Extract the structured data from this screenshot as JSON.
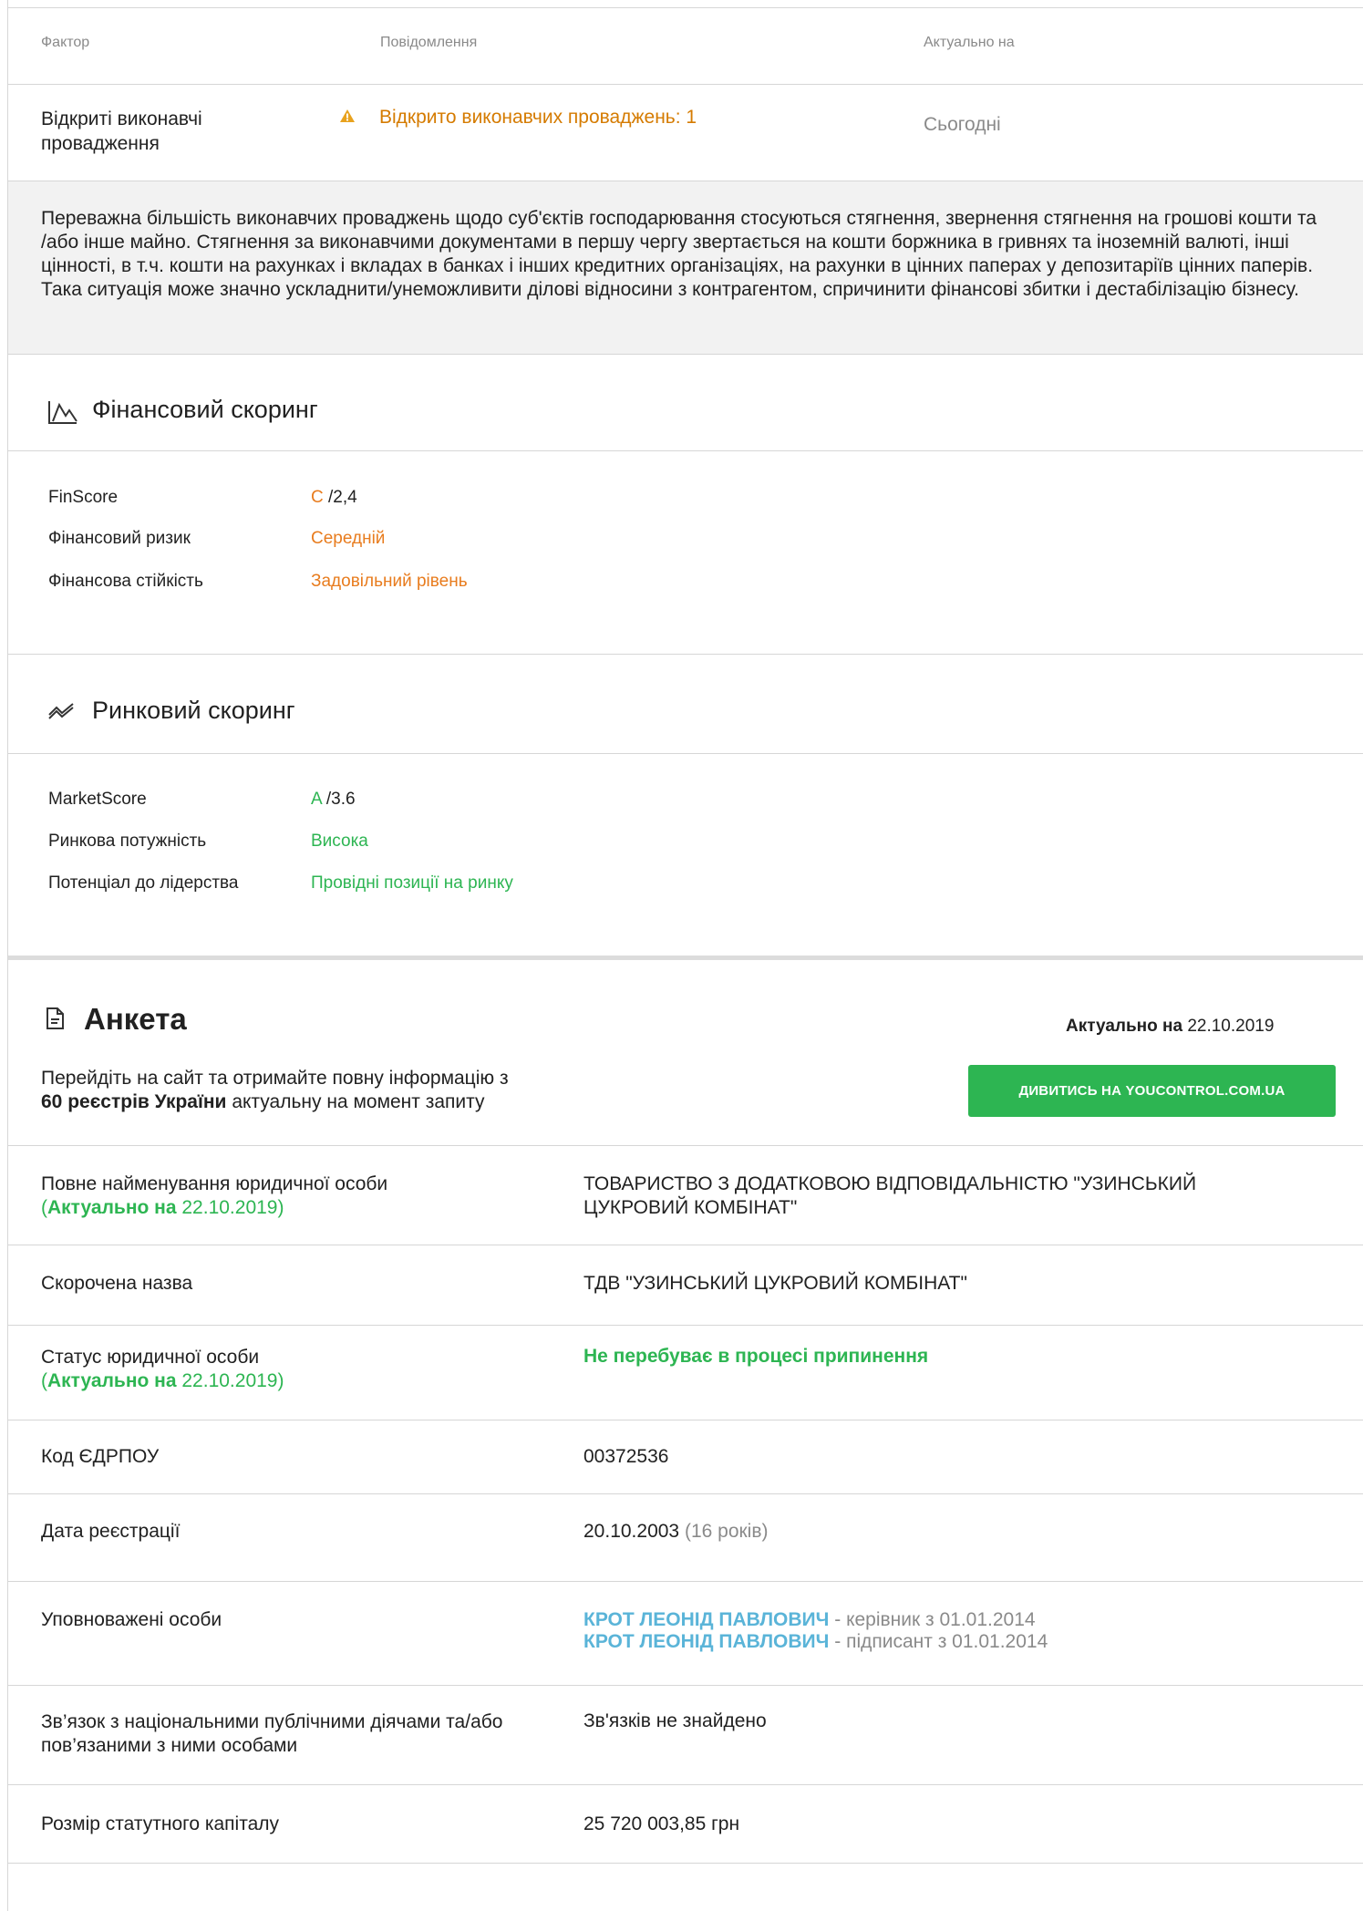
{
  "factors_table": {
    "headers": [
      "Фактор",
      "Повідомлення",
      "Актуально на"
    ],
    "row": {
      "factor": "Відкриті виконавчі провадження",
      "message": "Відкрито виконавчих проваджень: 1",
      "date": "Сьогодні"
    },
    "description": "Переважна більшість виконавчих проваджень щодо суб'єктів господарювання стосуються стягнення, звернення стягнення на грошові кошти та /або інше майно. Стягнення за виконавчими документами в першу чергу звертається на кошти боржника в гривнях та іноземній валюті, інші цінності, в т.ч. кошти на рахунках і вкладах в банках і інших кредитних організаціях, на рахунки в цінних паперах у депозитаріїв цінних паперів. Така ситуація може значно ускладнити/унеможливити ділові відносини з контрагентом, спричинити фінансові збитки і дестабілізацію бізнесу."
  },
  "financial_scoring": {
    "title": "Фінансовий скоринг",
    "rows": [
      {
        "label": "FinScore",
        "grade": "C",
        "score": " /2,4"
      },
      {
        "label": "Фінансовий ризик",
        "value": "Середній"
      },
      {
        "label": "Фінансова стійкість",
        "value": "Задовільний рівень"
      }
    ]
  },
  "market_scoring": {
    "title": "Ринковий скоринг",
    "rows": [
      {
        "label": "MarketScore",
        "grade": "A",
        "score": " /3.6"
      },
      {
        "label": "Ринкова потужність",
        "value": "Висока"
      },
      {
        "label": "Потенціал до лідерства",
        "value": "Провідні позиції на ринку"
      }
    ]
  },
  "anketa": {
    "title": "Анкета",
    "actual_label": "Актуально на",
    "actual_date": "22.10.2019",
    "promo_line1": "Перейдіть на сайт та отримайте повну інформацію з",
    "promo_count": "60",
    "promo_registries": "реєстрів України",
    "promo_tail": "актуальну на момент запиту",
    "button_label": "ДИВИТИСЬ НА YOUCONTROL.COM.UA",
    "rows": {
      "full_name_label": "Повне найменування юридичної особи",
      "full_name_actual_label": "Актуально на",
      "full_name_actual_date": "22.10.2019",
      "full_name_value": "ТОВАРИСТВО З ДОДАТКОВОЮ ВІДПОВІДАЛЬНІСТЮ \"УЗИНСЬКИЙ ЦУКРОВИЙ КОМБІНАТ\"",
      "short_name_label": "Скорочена назва",
      "short_name_value": "ТДВ \"УЗИНСЬКИЙ ЦУКРОВИЙ КОМБІНАТ\"",
      "status_label": "Статус юридичної особи",
      "status_actual_label": "Актуально на",
      "status_actual_date": "22.10.2019",
      "status_value": "Не перебуває в процесі припинення",
      "edrpou_label": "Код ЄДРПОУ",
      "edrpou_value": "00372536",
      "reg_date_label": "Дата реєстрації",
      "reg_date_value": "20.10.2003",
      "reg_date_age": "(16 років)",
      "authorized_label": "Уповноважені особи",
      "authorized_person1": "КРОТ ЛЕОНІД ПАВЛОВИЧ",
      "authorized_role1": " - керівник з 01.01.2014",
      "authorized_person2": "КРОТ ЛЕОНІД ПАВЛОВИЧ",
      "authorized_role2": " - підписант з 01.01.2014",
      "pep_label": "Зв’язок з національними публічними діячами та/або пов’язаними з ними особами",
      "pep_value": "Зв'язків не знайдено",
      "capital_label": "Розмір статутного капіталу",
      "capital_value": "25 720 003,85 грн"
    }
  },
  "colors": {
    "orange": "#e87c1e",
    "green": "#2db552",
    "blue": "#5ab4d8",
    "band": "#f2f2f2"
  },
  "icons": [
    "warning-icon",
    "chart-icon",
    "trend-icon",
    "document-icon"
  ]
}
